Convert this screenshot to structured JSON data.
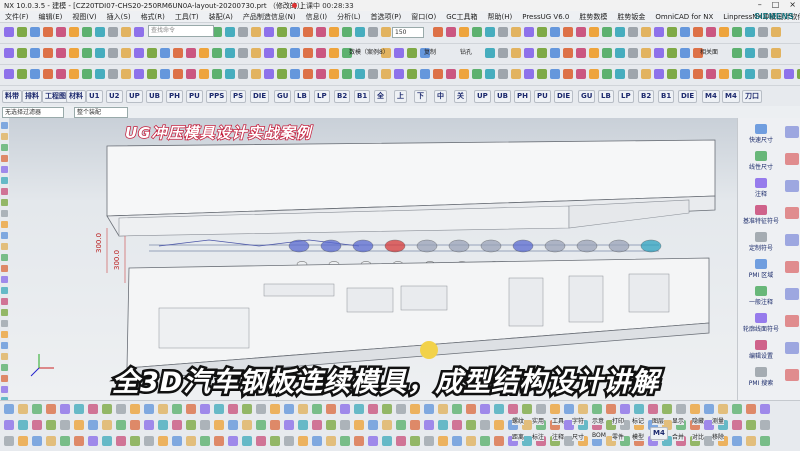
{
  "window": {
    "title": "NX 10.0.3.5 - 建模 - [CZ20TDI07-CHS20-250RM6UN0A-layout-20200730.prt （修改的）]",
    "recording": "上课中 00:28:33",
    "brand": "SIEMENS"
  },
  "menu": [
    "文件(F)",
    "编辑(E)",
    "视图(V)",
    "插入(S)",
    "格式(R)",
    "工具(T)",
    "装配(A)",
    "产品制造信息(N)",
    "信息(I)",
    "分析(L)",
    "首选项(P)",
    "窗口(O)",
    "GC工具箱",
    "帮助(H)",
    "PressUG V6.0",
    "胜势数模",
    "胜势钣金",
    "OmniCAD for NX",
    "LinpressNX冲模设计软件V3.1"
  ],
  "toolbar": {
    "search_placeholder": "查找命令",
    "zoom_value": "150",
    "labels_row2": [
      "数模（案例8）",
      "复制",
      "钻孔",
      "相关面"
    ],
    "labels_row3": [
      "图形",
      "孔大小",
      "铣削",
      "自动门阀",
      "材料",
      "中间框",
      "自动工序"
    ],
    "chips": [
      "料带",
      "排料",
      "工程图",
      "材料",
      "U1",
      "U2",
      "UP",
      "UB",
      "PH",
      "PU",
      "PPS",
      "PS",
      "DIE",
      "GU",
      "LB",
      "LP",
      "B2",
      "B1",
      "全",
      "上",
      "下",
      "中",
      "关",
      "UP",
      "UB",
      "PH",
      "PU",
      "DIE",
      "GU",
      "LB",
      "LP",
      "B2",
      "B1",
      "DIE",
      "M4",
      "M4",
      "刀口"
    ],
    "filter_left": "无选择过滤器",
    "filter_right": "整个装配"
  },
  "right_panel": [
    "快速尺寸",
    "线性尺寸",
    "注释",
    "基准特征符号",
    "定制符号",
    "PMI 区域",
    "一般注释",
    "轮廓线面符号",
    "编辑设置",
    "PMI 搜索"
  ],
  "viewport": {
    "dims": [
      "300.0",
      "300.0"
    ],
    "overlay_title": "UG冲压模具设计实战案例",
    "overlay_subtitle": "全3D汽车钢板连续模具，成型结构设计讲解"
  },
  "bottom_toolbar": {
    "labels": [
      "螺纹",
      "实用",
      "工具",
      "字符",
      "示意",
      "打印",
      "标记",
      "图层",
      "显示",
      "隐藏",
      "测量",
      "距离",
      "标注",
      "注释",
      "尺寸",
      "BOM",
      "零件",
      "模型",
      "组合",
      "合并",
      "对比",
      "移除"
    ],
    "chips": [
      "M4"
    ]
  },
  "colors": {
    "brand": "#0b6e78",
    "title_stroke": "#c41d3b",
    "plate": "#f6f7f8",
    "plate_edge": "#6a6f77"
  }
}
